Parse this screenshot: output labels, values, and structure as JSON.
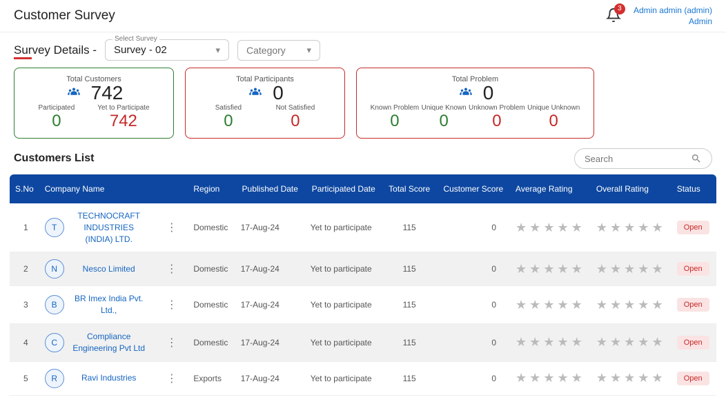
{
  "header": {
    "title": "Customer Survey",
    "notification_count": "3",
    "user_line1": "Admin admin (admin)",
    "user_line2": "Admin"
  },
  "subheader": {
    "details_label_pre": "Sur",
    "details_label_post": "vey Details  -",
    "select_survey_label": "Select Survey",
    "select_survey_value": "Survey - 02",
    "category_label": "Category"
  },
  "cards": {
    "c1": {
      "title": "Total Customers",
      "main": "742",
      "sub": [
        {
          "label": "Participated",
          "value": "0",
          "class": "green-txt"
        },
        {
          "label": "Yet to Participate",
          "value": "742",
          "class": "red-txt"
        }
      ]
    },
    "c2": {
      "title": "Total Participants",
      "main": "0",
      "sub": [
        {
          "label": "Satisfied",
          "value": "0",
          "class": "green-txt"
        },
        {
          "label": "Not Satisfied",
          "value": "0",
          "class": "red-txt"
        }
      ]
    },
    "c3": {
      "title": "Total Problem",
      "main": "0",
      "sub": [
        {
          "label": "Known Problem",
          "value": "0",
          "class": "green-txt"
        },
        {
          "label": "Unique Known",
          "value": "0",
          "class": "green-txt"
        },
        {
          "label": "Unknown Problem",
          "value": "0",
          "class": "red-txt"
        },
        {
          "label": "Unique Unknown",
          "value": "0",
          "class": "red-txt"
        }
      ]
    }
  },
  "list": {
    "title": "Customers List",
    "search_placeholder": "Search",
    "columns": [
      "S.No",
      "Company Name",
      "",
      "Region",
      "Published Date",
      "Participated Date",
      "Total Score",
      "Customer Score",
      "Average Rating",
      "Overall Rating",
      "Status"
    ],
    "rows": [
      {
        "sno": "1",
        "initial": "T",
        "company": "TECHNOCRAFT INDUSTRIES (INDIA) LTD.",
        "region": "Domestic",
        "published": "17-Aug-24",
        "participated": "Yet to participate",
        "total": "115",
        "customer": "0",
        "status": "Open"
      },
      {
        "sno": "2",
        "initial": "N",
        "company": "Nesco Limited",
        "region": "Domestic",
        "published": "17-Aug-24",
        "participated": "Yet to participate",
        "total": "115",
        "customer": "0",
        "status": "Open"
      },
      {
        "sno": "3",
        "initial": "B",
        "company": "BR Imex India Pvt. Ltd.,",
        "region": "Domestic",
        "published": "17-Aug-24",
        "participated": "Yet to participate",
        "total": "115",
        "customer": "0",
        "status": "Open"
      },
      {
        "sno": "4",
        "initial": "C",
        "company": "Compliance Engineering Pvt Ltd",
        "region": "Domestic",
        "published": "17-Aug-24",
        "participated": "Yet to participate",
        "total": "115",
        "customer": "0",
        "status": "Open"
      },
      {
        "sno": "5",
        "initial": "R",
        "company": "Ravi Industries",
        "region": "Exports",
        "published": "17-Aug-24",
        "participated": "Yet to participate",
        "total": "115",
        "customer": "0",
        "status": "Open"
      }
    ]
  }
}
